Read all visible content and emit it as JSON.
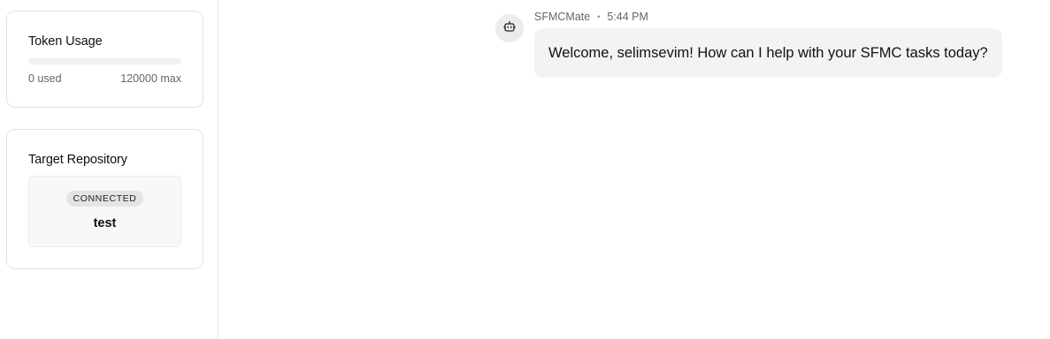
{
  "sidebar": {
    "token_usage": {
      "title": "Token Usage",
      "used_label": "0 used",
      "max_label": "120000 max",
      "used": 0,
      "max": 120000
    },
    "target_repository": {
      "title": "Target Repository",
      "status": "CONNECTED",
      "name": "test"
    }
  },
  "chat": {
    "messages": [
      {
        "sender": "SFMCMate",
        "separator": "•",
        "time": "5:44 PM",
        "avatar_icon": "robot-icon",
        "text": "Welcome, selimsevim! How can I help with your SFMC tasks today?"
      }
    ]
  },
  "colors": {
    "progress_track": "#f0f0f0",
    "bubble_bg": "#f3f3f3",
    "badge_bg": "#e4e4e4"
  }
}
